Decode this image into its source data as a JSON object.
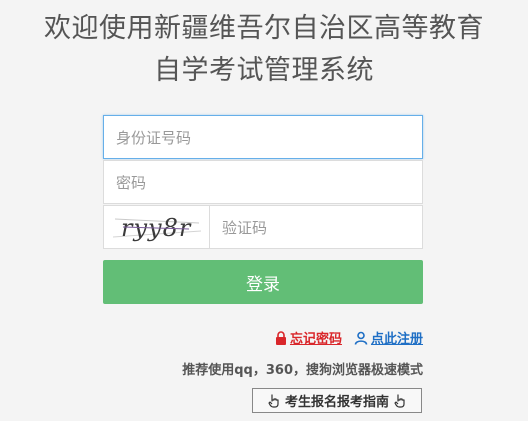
{
  "title": {
    "line1": "欢迎使用新疆维吾尔自治区高等教育",
    "line2": "自学考试管理系统"
  },
  "form": {
    "id_placeholder": "身份证号码",
    "password_placeholder": "密码",
    "captcha_text": "ryy8r",
    "captcha_placeholder": "验证码",
    "login_label": "登录"
  },
  "links": {
    "forgot_label": "忘记密码",
    "register_label": "点此注册"
  },
  "tip": "推荐使用qq，360，搜狗浏览器极速模式",
  "guide_label": "考生报名报考指南",
  "icons": [
    "lock-icon",
    "user-icon",
    "hand-pointer-left-icon",
    "hand-pointer-right-icon"
  ],
  "colors": {
    "login_button": "#62be76",
    "forgot_link": "#d9262a",
    "register_link": "#1f6fc5",
    "input_focus_border": "#66afe9"
  }
}
